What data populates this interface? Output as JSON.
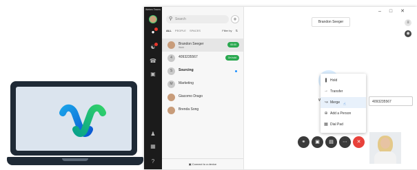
{
  "app": {
    "title": "Webex Teams"
  },
  "rail": {
    "icons": [
      "avatar",
      "chat-icon",
      "teams-icon",
      "phone-icon",
      "meetings-icon",
      "contacts-icon",
      "apps-icon",
      "help-icon"
    ]
  },
  "search": {
    "placeholder": "Search",
    "add_label": "+"
  },
  "tabs": {
    "all": "ALL",
    "people": "PEOPLE",
    "spaces": "SPACES",
    "filter": "Filter by"
  },
  "contacts": [
    {
      "name": "Brandon Seeger",
      "sub": "Work",
      "badge": "00:00"
    },
    {
      "name": "4093235567",
      "sub": "",
      "badge": "On hold",
      "initial": "4"
    },
    {
      "name": "Sourcing",
      "initial": "S"
    },
    {
      "name": "Marketing",
      "initial": "M"
    },
    {
      "name": "Giacomo Drago"
    },
    {
      "name": "Brenda Song"
    }
  ],
  "connect_label": "Connect to a device",
  "call": {
    "title": "Brandon Seeger",
    "caller_partial": "Wo"
  },
  "menu": {
    "items": [
      {
        "label": "Hold",
        "icon": "hold-icon"
      },
      {
        "label": "Transfer",
        "icon": "transfer-icon"
      },
      {
        "label": "Merge",
        "icon": "merge-icon"
      },
      {
        "label": "Add a Person",
        "icon": "add-person-icon"
      },
      {
        "label": "Dial Pad",
        "icon": "dialpad-icon"
      }
    ]
  },
  "merge_number": "4093235567",
  "colors": {
    "accent_green": "#2aa84f",
    "end_call_red": "#e8413a"
  }
}
